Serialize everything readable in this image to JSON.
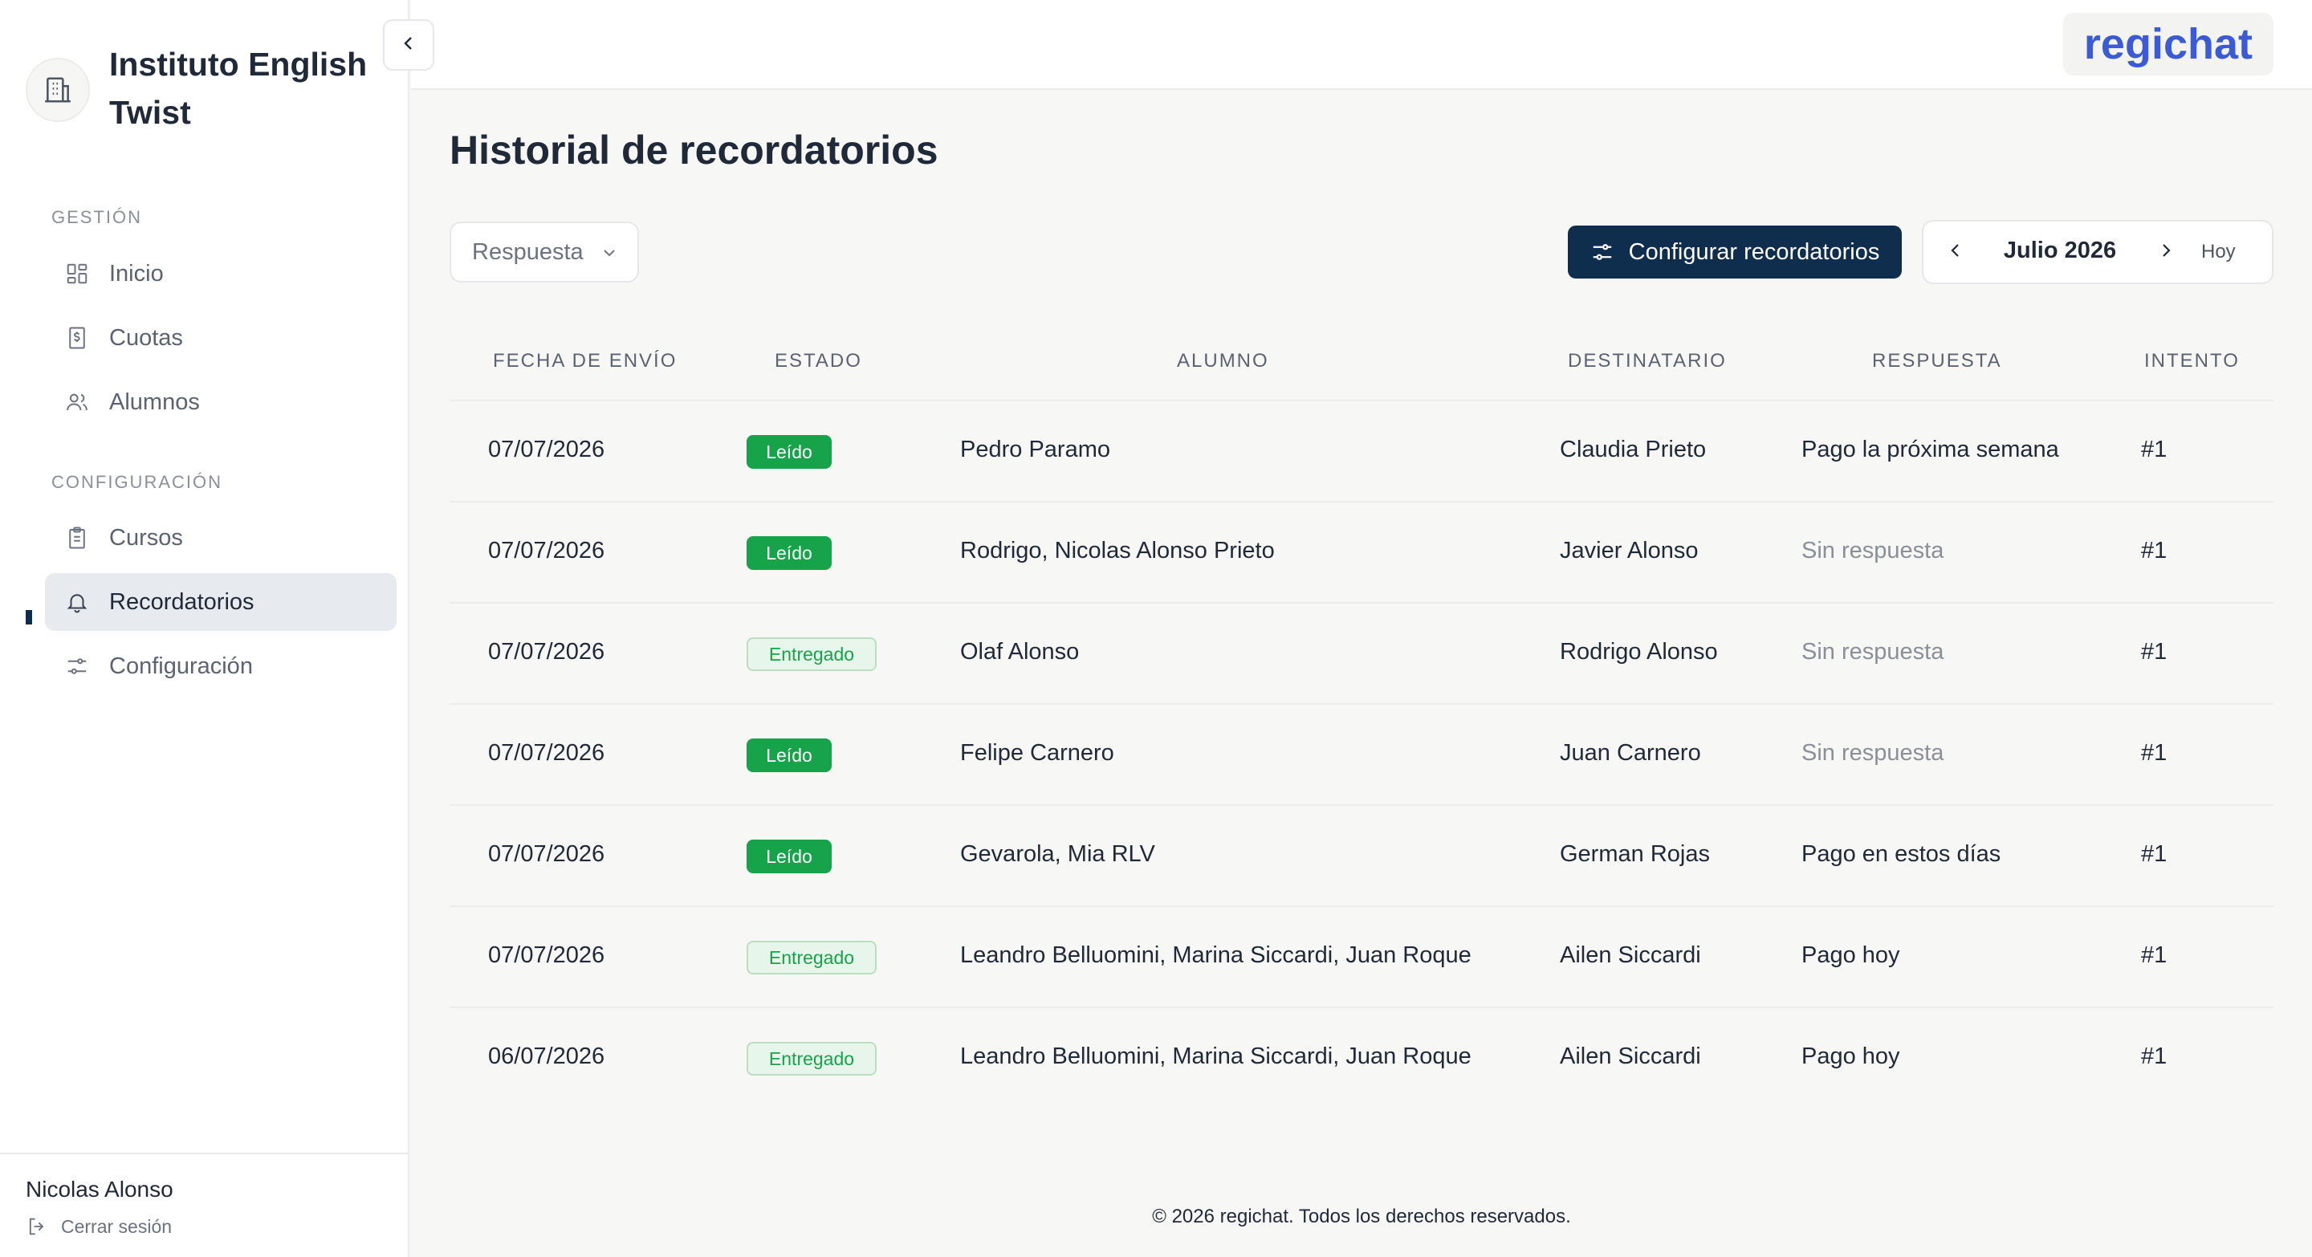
{
  "sidebar": {
    "org_name": "Instituto English Twist",
    "sections": [
      {
        "label": "GESTIÓN",
        "items": [
          {
            "label": "Inicio",
            "icon": "grid-icon"
          },
          {
            "label": "Cuotas",
            "icon": "dollar-receipt-icon"
          },
          {
            "label": "Alumnos",
            "icon": "users-icon"
          }
        ]
      },
      {
        "label": "CONFIGURACIÓN",
        "items": [
          {
            "label": "Cursos",
            "icon": "clipboard-icon"
          },
          {
            "label": "Recordatorios",
            "icon": "bell-icon",
            "active": true
          },
          {
            "label": "Configuración",
            "icon": "sliders-icon"
          }
        ]
      }
    ],
    "user_name": "Nicolas Alonso",
    "logout_label": "Cerrar sesión"
  },
  "topbar": {
    "brand": "regichat"
  },
  "page": {
    "title": "Historial de recordatorios"
  },
  "filters": {
    "response_filter": "Respuesta"
  },
  "actions": {
    "config_button": "Configurar recordatorios"
  },
  "month_nav": {
    "label": "Julio 2026",
    "today_label": "Hoy"
  },
  "table": {
    "headers": [
      "FECHA DE ENVÍO",
      "ESTADO",
      "ALUMNO",
      "DESTINATARIO",
      "RESPUESTA",
      "INTENTO"
    ],
    "rows": [
      {
        "date": "07/07/2026",
        "status": "Leído",
        "student": "Pedro Paramo",
        "recipient": "Claudia Prieto",
        "response": "Pago la próxima semana",
        "attempt": "#1"
      },
      {
        "date": "07/07/2026",
        "status": "Leído",
        "student": "Rodrigo, Nicolas Alonso Prieto",
        "recipient": "Javier Alonso",
        "response": "Sin respuesta",
        "attempt": "#1"
      },
      {
        "date": "07/07/2026",
        "status": "Entregado",
        "student": "Olaf Alonso",
        "recipient": "Rodrigo Alonso",
        "response": "Sin respuesta",
        "attempt": "#1"
      },
      {
        "date": "07/07/2026",
        "status": "Leído",
        "student": "Felipe Carnero",
        "recipient": "Juan Carnero",
        "response": "Sin respuesta",
        "attempt": "#1"
      },
      {
        "date": "07/07/2026",
        "status": "Leído",
        "student": "Gevarola, Mia RLV",
        "recipient": "German Rojas",
        "response": "Pago en estos días",
        "attempt": "#1"
      },
      {
        "date": "07/07/2026",
        "status": "Entregado",
        "student": "Leandro Belluomini, Marina Siccardi, Juan Roque",
        "recipient": "Ailen Siccardi",
        "response": "Pago hoy",
        "attempt": "#1"
      },
      {
        "date": "06/07/2026",
        "status": "Entregado",
        "student": "Leandro Belluomini, Marina Siccardi, Juan Roque",
        "recipient": "Ailen Siccardi",
        "response": "Pago hoy",
        "attempt": "#1"
      }
    ]
  },
  "footer": {
    "text": "© 2026 regichat. Todos los derechos reservados."
  },
  "colors": {
    "brand": "#3b5bd6",
    "primary": "#0f2e4d",
    "success": "#16a34a"
  }
}
